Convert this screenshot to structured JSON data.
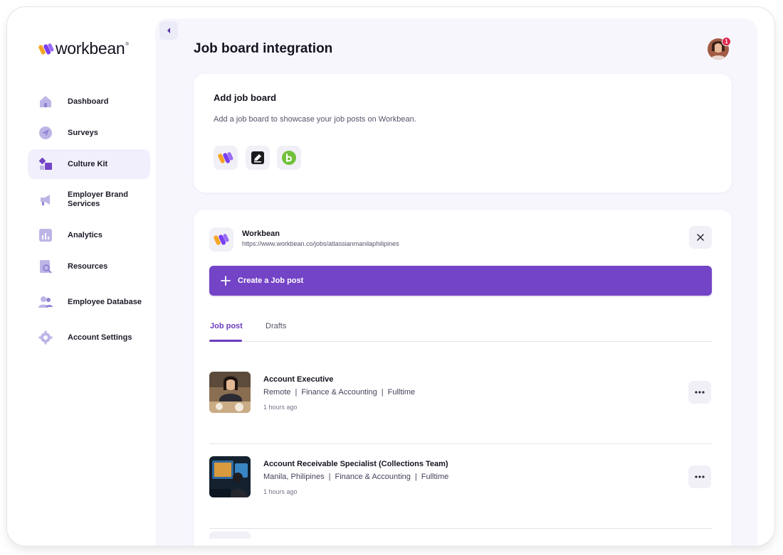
{
  "brand": {
    "name": "workbean",
    "registered": "®",
    "colors": {
      "primary": "#7444c7",
      "accent_orange": "#f5a623",
      "accent_purple": "#7b3ff2",
      "badge": "#e02348"
    }
  },
  "sidebar": {
    "items": [
      {
        "label": "Dashboard",
        "icon": "home-icon",
        "active": false
      },
      {
        "label": "Surveys",
        "icon": "send-icon",
        "active": false
      },
      {
        "label": "Culture Kit",
        "icon": "shapes-icon",
        "active": true
      },
      {
        "label": "Employer Brand Services",
        "icon": "megaphone-icon",
        "active": false
      },
      {
        "label": "Analytics",
        "icon": "bar-chart-icon",
        "active": false
      },
      {
        "label": "Resources",
        "icon": "document-search-icon",
        "active": false
      },
      {
        "label": "Employee Database",
        "icon": "users-icon",
        "active": false
      },
      {
        "label": "Account Settings",
        "icon": "gear-icon",
        "active": false
      }
    ]
  },
  "header": {
    "title": "Job board integration",
    "notification_count": "1"
  },
  "add_board": {
    "title": "Add job board",
    "description": "Add a job board to showcase your job posts on Workbean.",
    "boards": [
      {
        "icon": "workbean-logo-icon"
      },
      {
        "icon": "pen-square-icon"
      },
      {
        "icon": "bamboo-b-icon"
      }
    ]
  },
  "integration": {
    "name": "Workbean",
    "url": "https://www.workbean.co/jobs/atlassianmanilaphilipines",
    "create_label": "Create a Job post",
    "tabs": [
      {
        "label": "Job post",
        "active": true
      },
      {
        "label": "Drafts",
        "active": false
      }
    ],
    "jobs": [
      {
        "title": "Account Executive",
        "location": "Remote",
        "department": "Finance & Accounting",
        "type": "Fulltime",
        "posted": "1 hours ago"
      },
      {
        "title": "Account Receivable Specialist (Collections Team)",
        "location": "Manila, Philipines",
        "department": "Finance & Accounting",
        "type": "Fulltime",
        "posted": "1 hours ago"
      }
    ],
    "separator": "|"
  }
}
